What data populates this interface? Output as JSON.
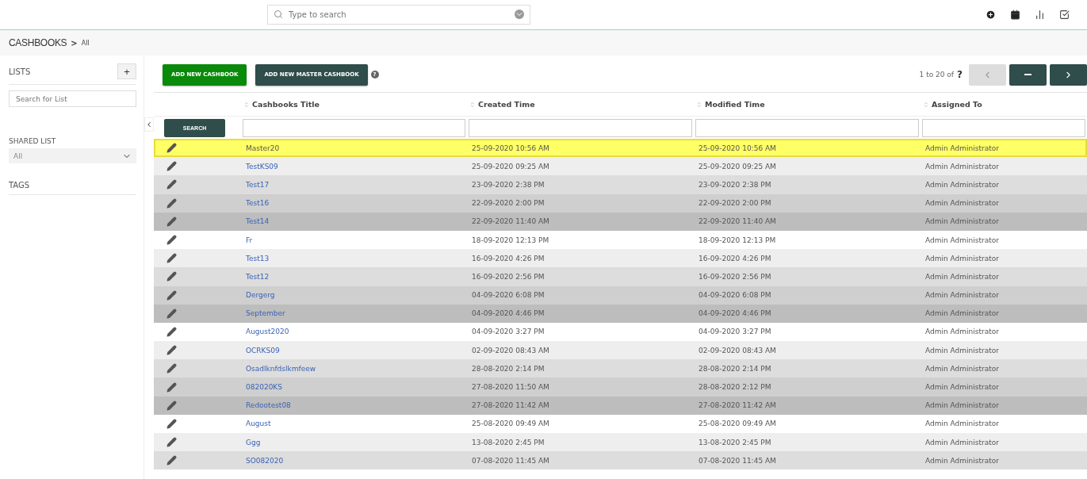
{
  "top_search": {
    "placeholder": "Type to search"
  },
  "breadcrumb": {
    "module": "CASHBOOKS",
    "separator": ">",
    "view": "All"
  },
  "sidebar": {
    "lists_title": "LISTS",
    "add_label": "+",
    "list_search": {
      "placeholder": "Search for List"
    },
    "shared_list_title": "SHARED LIST",
    "shared_list_value": "All",
    "tags_title": "TAGS"
  },
  "toolbar": {
    "add_button": "ADD NEW CASHBOOK",
    "add_master_button": "ADD NEW MASTER CASHBOOK",
    "help_label": "?",
    "paging": "1 to 20  of",
    "paging_total": "?"
  },
  "table": {
    "columns": [
      "Cashbooks Title",
      "Created Time",
      "Modified Time",
      "Assigned To"
    ],
    "search_button": "SEARCH",
    "rows": [
      {
        "title": "Master20",
        "created": "25-09-2020 10:56 AM",
        "modified": "25-09-2020 10:56 AM",
        "assigned": "Admin Administrator",
        "selected": true
      },
      {
        "title": "TestKS09",
        "created": "25-09-2020 09:25 AM",
        "modified": "25-09-2020 09:25 AM",
        "assigned": "Admin Administrator",
        "selected": false
      },
      {
        "title": "Test17",
        "created": "23-09-2020 2:38 PM",
        "modified": "23-09-2020 2:38 PM",
        "assigned": "Admin Administrator",
        "selected": false
      },
      {
        "title": "Test16",
        "created": "22-09-2020 2:00 PM",
        "modified": "22-09-2020 2:00 PM",
        "assigned": "Admin Administrator",
        "selected": false
      },
      {
        "title": "Test14",
        "created": "22-09-2020 11:40 AM",
        "modified": "22-09-2020 11:40 AM",
        "assigned": "Admin Administrator",
        "selected": false
      },
      {
        "title": "Fr",
        "created": "18-09-2020 12:13 PM",
        "modified": "18-09-2020 12:13 PM",
        "assigned": "Admin Administrator",
        "selected": false
      },
      {
        "title": "Test13",
        "created": "16-09-2020 4:26 PM",
        "modified": "16-09-2020 4:26 PM",
        "assigned": "Admin Administrator",
        "selected": false
      },
      {
        "title": "Test12",
        "created": "16-09-2020 2:56 PM",
        "modified": "16-09-2020 2:56 PM",
        "assigned": "Admin Administrator",
        "selected": false
      },
      {
        "title": "Dergerg",
        "created": "04-09-2020 6:08 PM",
        "modified": "04-09-2020 6:08 PM",
        "assigned": "Admin Administrator",
        "selected": false
      },
      {
        "title": "September",
        "created": "04-09-2020 4:46 PM",
        "modified": "04-09-2020 4:46 PM",
        "assigned": "Admin Administrator",
        "selected": false
      },
      {
        "title": "August2020",
        "created": "04-09-2020 3:27 PM",
        "modified": "04-09-2020 3:27 PM",
        "assigned": "Admin Administrator",
        "selected": false
      },
      {
        "title": "OCRKS09",
        "created": "02-09-2020 08:43 AM",
        "modified": "02-09-2020 08:43 AM",
        "assigned": "Admin Administrator",
        "selected": false
      },
      {
        "title": "Osadlknfdslkmfeew",
        "created": "28-08-2020 2:14 PM",
        "modified": "28-08-2020 2:14 PM",
        "assigned": "Admin Administrator",
        "selected": false
      },
      {
        "title": "082020KS",
        "created": "27-08-2020 11:50 AM",
        "modified": "28-08-2020 2:12 PM",
        "assigned": "Admin Administrator",
        "selected": false
      },
      {
        "title": "Redootest08",
        "created": "27-08-2020 11:42 AM",
        "modified": "27-08-2020 11:42 AM",
        "assigned": "Admin Administrator",
        "selected": false
      },
      {
        "title": "August",
        "created": "25-08-2020 09:49 AM",
        "modified": "25-08-2020 09:49 AM",
        "assigned": "Admin Administrator",
        "selected": false
      },
      {
        "title": "Ggg",
        "created": "13-08-2020 2:45 PM",
        "modified": "13-08-2020 2:45 PM",
        "assigned": "Admin Administrator",
        "selected": false
      },
      {
        "title": "SO082020",
        "created": "07-08-2020 11:45 AM",
        "modified": "07-08-2020 11:45 AM",
        "assigned": "Admin Administrator",
        "selected": false
      }
    ]
  }
}
